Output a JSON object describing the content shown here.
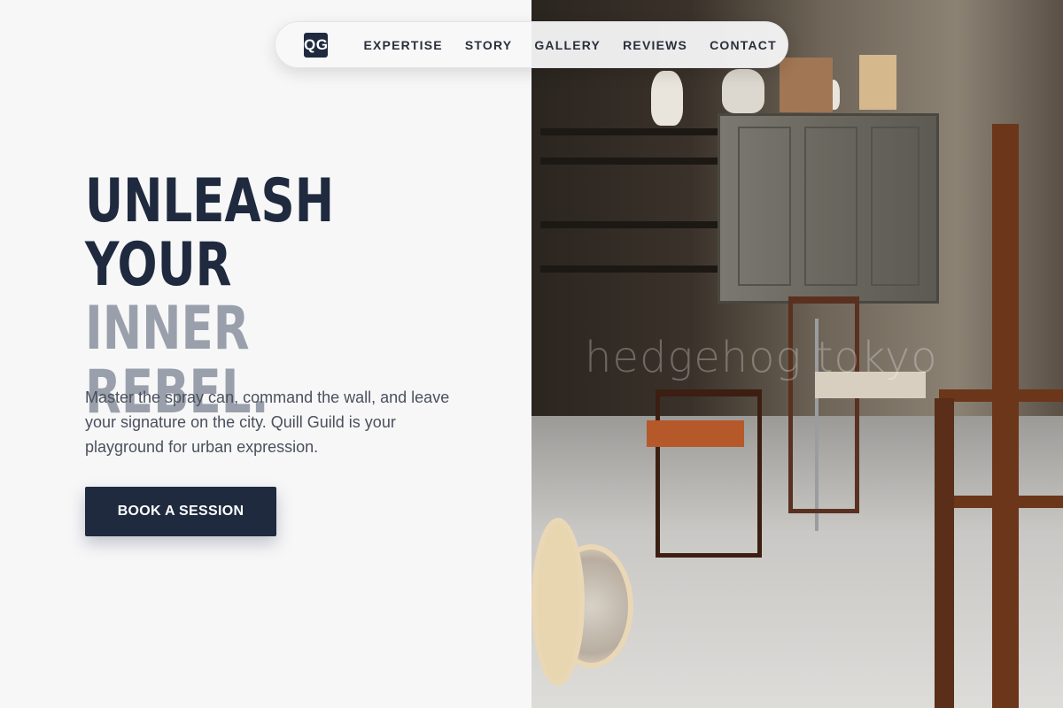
{
  "nav": {
    "logo": "QG",
    "links": [
      "EXPERTISE",
      "STORY",
      "GALLERY",
      "REVIEWS",
      "CONTACT"
    ]
  },
  "hero": {
    "title_line1": "UNLEASH",
    "title_line2": "YOUR",
    "title_line3": "INNER REBEL.",
    "description": "Master the spray can, command the wall, and leave your signature on the city. Quill Guild is your playground for urban expression.",
    "cta_label": "BOOK A SESSION"
  },
  "photo": {
    "watermark": "hedgehog tokyo",
    "subject": "cluttered pottery studio with wooden chairs, shelves and a kiln"
  },
  "colors": {
    "navy": "#1f2a3f",
    "muted_gray": "#9aa0ab",
    "background": "#f7f7f8"
  }
}
